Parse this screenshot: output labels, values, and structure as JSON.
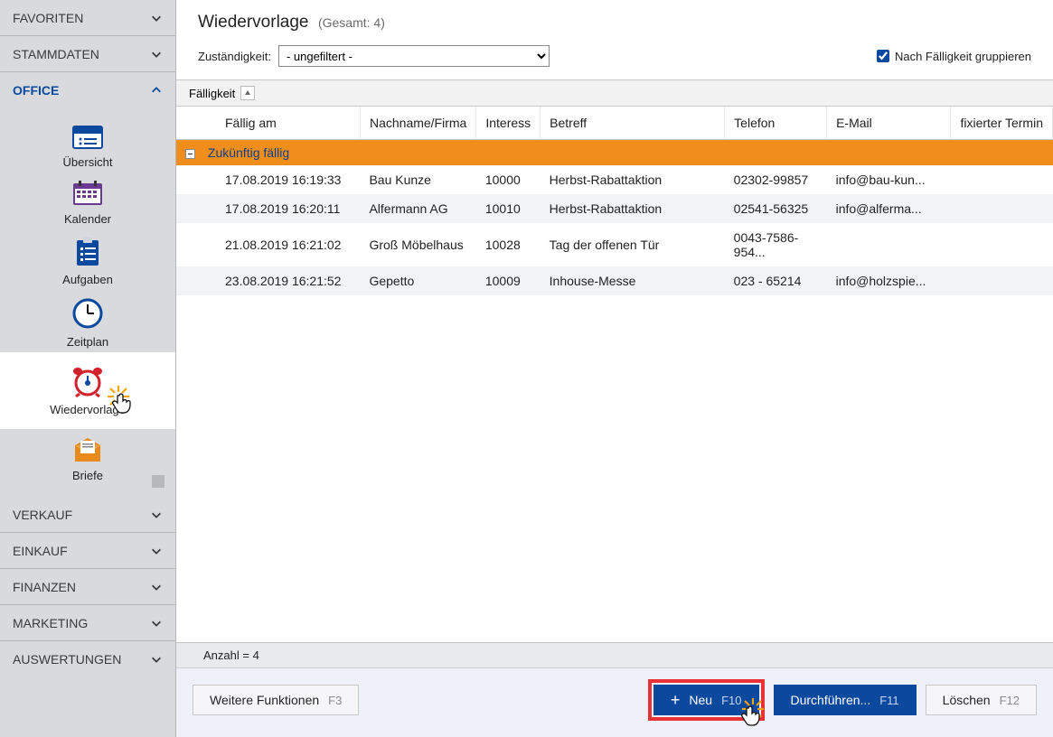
{
  "sidebar": {
    "sections": {
      "favoriten": "FAVORITEN",
      "stammdaten": "STAMMDATEN",
      "office": "OFFICE",
      "verkauf": "VERKAUF",
      "einkauf": "EINKAUF",
      "finanzen": "FINANZEN",
      "marketing": "MARKETING",
      "auswertungen": "AUSWERTUNGEN"
    },
    "office_items": {
      "uebersicht": "Übersicht",
      "kalender": "Kalender",
      "aufgaben": "Aufgaben",
      "zeitplan": "Zeitplan",
      "wiedervorlage": "Wiedervorlage",
      "briefe": "Briefe"
    }
  },
  "header": {
    "title": "Wiedervorlage",
    "count_label": "(Gesamt: 4)"
  },
  "filter": {
    "label": "Zuständigkeit:",
    "selected": "- ungefiltert -",
    "group_checkbox_label": "Nach Fälligkeit gruppieren"
  },
  "group_panel": {
    "field": "Fälligkeit"
  },
  "columns": {
    "faellig_am": "Fällig am",
    "nachname": "Nachname/Firma",
    "interesse": "Interess",
    "betreff": "Betreff",
    "telefon": "Telefon",
    "email": "E-Mail",
    "fix_termin": "fixierter Termin"
  },
  "group_row": {
    "label": "Zukünftig fällig"
  },
  "rows": [
    {
      "date": "17.08.2019 16:19:33",
      "name": "Bau Kunze",
      "int": "10000",
      "sub": "Herbst-Rabattaktion",
      "tel": "02302-99857",
      "mail": "info@bau-kun...",
      "fix": ""
    },
    {
      "date": "17.08.2019 16:20:11",
      "name": "Alfermann AG",
      "int": "10010",
      "sub": "Herbst-Rabattaktion",
      "tel": "02541-56325",
      "mail": "info@alferma...",
      "fix": ""
    },
    {
      "date": "21.08.2019 16:21:02",
      "name": "Groß Möbelhaus",
      "int": "10028",
      "sub": "Tag der offenen Tür",
      "tel": "0043-7586-954...",
      "mail": "",
      "fix": ""
    },
    {
      "date": "23.08.2019 16:21:52",
      "name": "Gepetto",
      "int": "10009",
      "sub": "Inhouse-Messe",
      "tel": "023 - 65214",
      "mail": "info@holzspie...",
      "fix": ""
    }
  ],
  "statusbar": {
    "count": "Anzahl = 4"
  },
  "footer": {
    "more": "Weitere Funktionen",
    "more_key": "F3",
    "neu": "Neu",
    "neu_key": "F10",
    "durch": "Durchführen...",
    "durch_key": "F11",
    "loeschen": "Löschen",
    "loeschen_key": "F12"
  }
}
